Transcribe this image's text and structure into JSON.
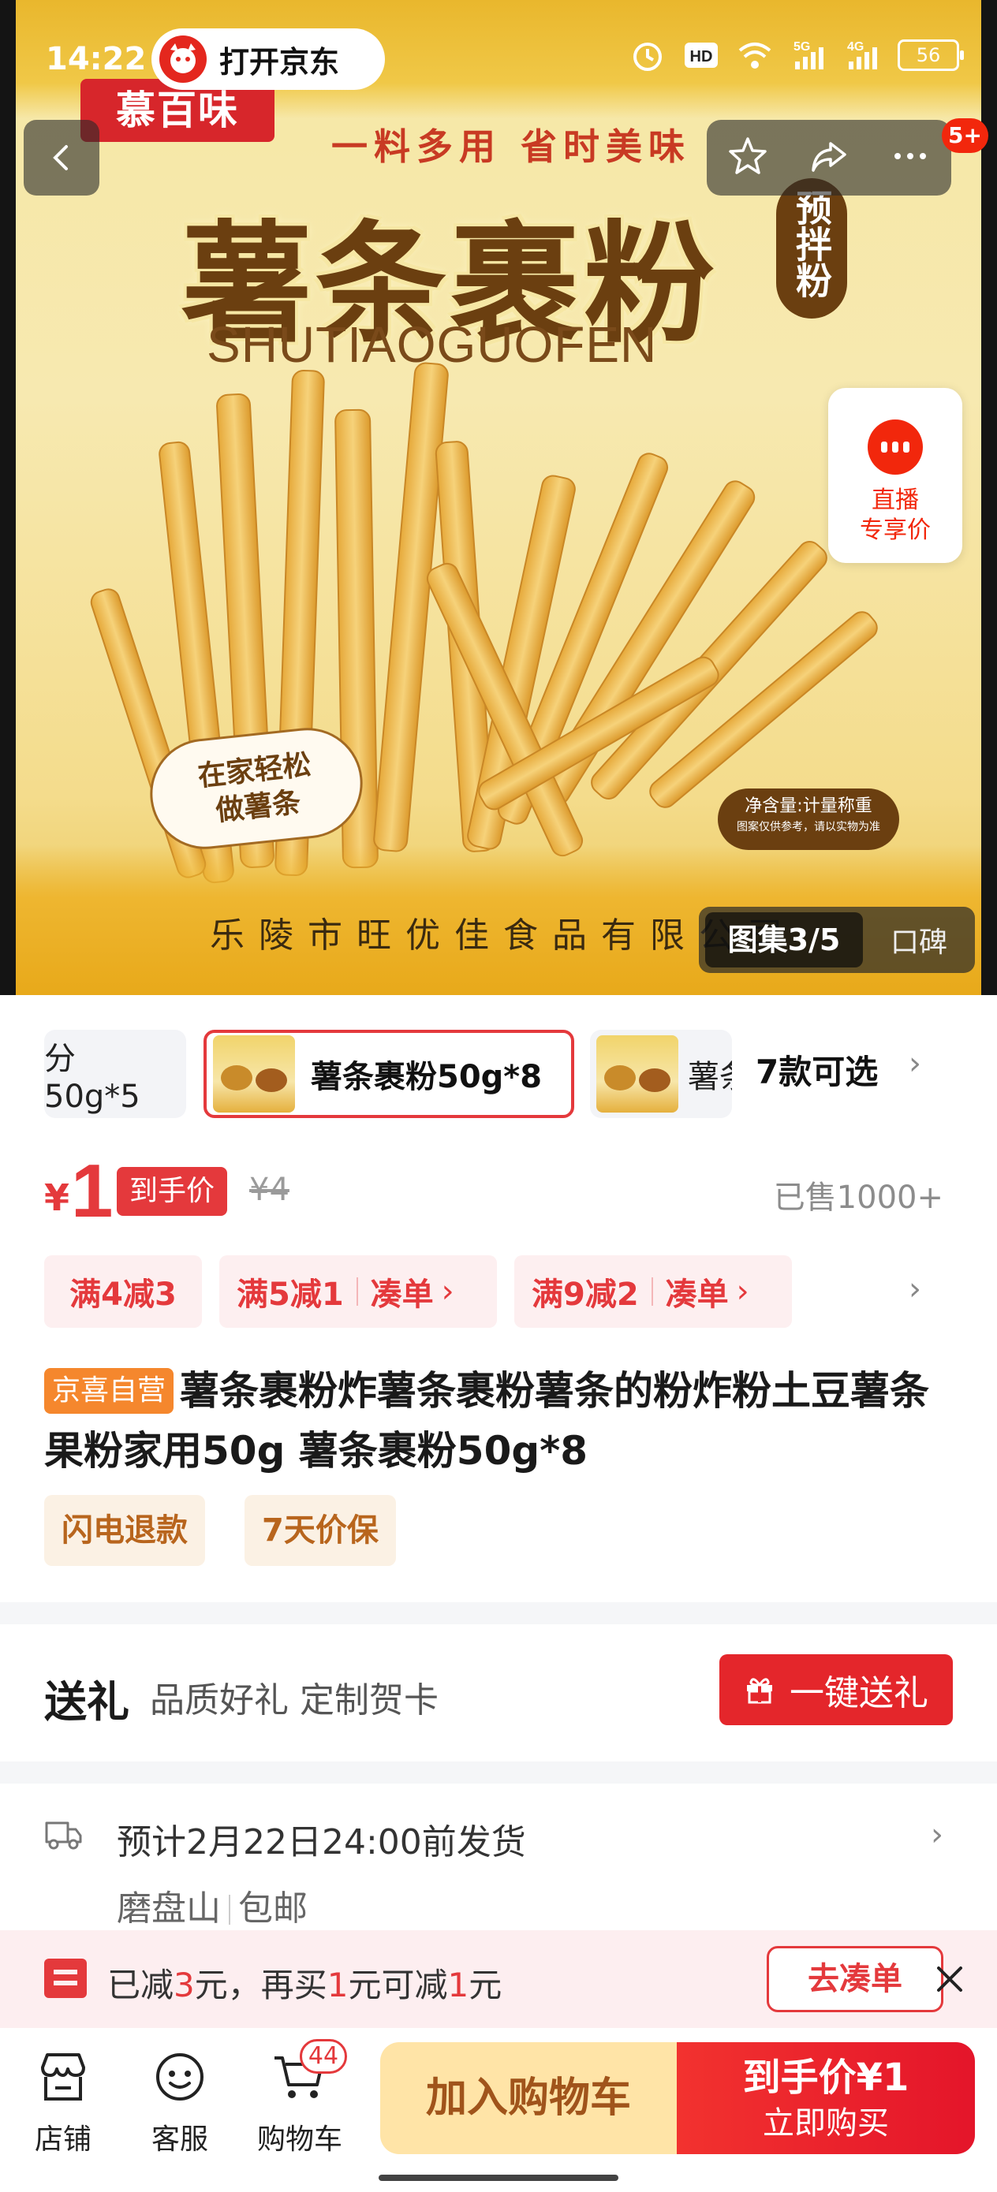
{
  "status_bar": {
    "time": "14:22",
    "network": "5G",
    "network2": "4G",
    "battery": "56"
  },
  "top": {
    "open_app_label": "打开京东",
    "more_badge": "5+"
  },
  "product_image": {
    "brand": "慕百味",
    "slogan": "一料多用 省时美味",
    "title": "薯条裹粉",
    "pinyin": "SHUTIAOGUOFEN",
    "tag": "预拌粉",
    "bubble_line1": "在家轻松",
    "bubble_line2": "做薯条",
    "net_weight": "净含量:计量称重",
    "note": "图案仅供参考，请以实物为准",
    "maker": "乐陵市旺优佳食品有限公司"
  },
  "live": {
    "line1": "直播",
    "line2": "专享价"
  },
  "gallery": {
    "counter": "图集3/5",
    "reviews": "口碑"
  },
  "variants": {
    "items": [
      {
        "label": "分50g*5"
      },
      {
        "label": "薯条裹粉50g*8"
      },
      {
        "label": "薯条"
      }
    ],
    "more": "7款可选"
  },
  "price": {
    "currency": "¥",
    "value": "1",
    "tag": "到手价",
    "original": "¥4",
    "sold": "已售1000+"
  },
  "coupons": [
    {
      "text": "满4减3"
    },
    {
      "text": "满5减1",
      "action": "凑单"
    },
    {
      "text": "满9减2",
      "action": "凑单"
    }
  ],
  "title": {
    "badge": "京喜自营",
    "text": "薯条裹粉炸薯条裹粉薯条的粉炸粉土豆薯条果粉家用50g 薯条裹粉50g*8"
  },
  "services": [
    "闪电退款",
    "7天价保"
  ],
  "gift": {
    "title": "送礼",
    "subtitle": "品质好礼 定制贺卡",
    "button": "一键送礼"
  },
  "shipping": {
    "text": "预计2月22日24:00前发货",
    "location": "磨盘山",
    "free": "包邮"
  },
  "promo": {
    "p1": "已减",
    "n1": "3",
    "p2": "元，再买",
    "n2": "1",
    "p3": "元可减",
    "n3": "1",
    "p4": "元",
    "button": "去凑单"
  },
  "bottom_nav": {
    "store": "店铺",
    "service": "客服",
    "cart": "购物车",
    "cart_count": "44",
    "add_to_cart": "加入购物车",
    "buy_price": "到手价¥1",
    "buy_now": "立即购买"
  },
  "colors": {
    "accent_red": "#e4393c",
    "brand_red": "#f2270c",
    "add_cart_bg": "#ffe4a7"
  }
}
